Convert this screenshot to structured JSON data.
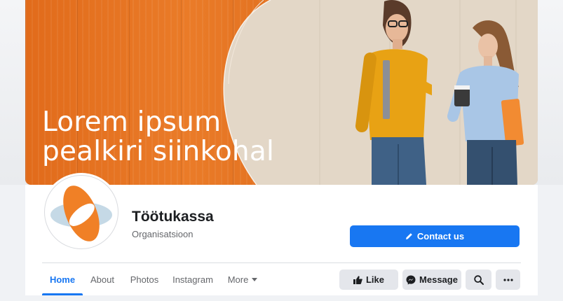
{
  "cover": {
    "headline_line1": "Lorem ipsum",
    "headline_line2": "pealkiri siinkohal",
    "accent_color": "#e8762a"
  },
  "profile": {
    "name": "Töötukassa",
    "category": "Organisatsioon",
    "logo_icon": "tootukassa-logo-icon"
  },
  "actions": {
    "contact_label": "Contact us",
    "like_label": "Like",
    "message_label": "Message",
    "search_icon": "search-icon",
    "more_icon": "more-dots-icon"
  },
  "tabs": [
    {
      "label": "Home",
      "active": true
    },
    {
      "label": "About",
      "active": false
    },
    {
      "label": "Photos",
      "active": false
    },
    {
      "label": "Instagram",
      "active": false
    },
    {
      "label": "More",
      "active": false
    }
  ],
  "colors": {
    "primary": "#1877f2",
    "secondary_button": "#e4e6eb",
    "text": "#1c1e21",
    "muted": "#65676b"
  }
}
